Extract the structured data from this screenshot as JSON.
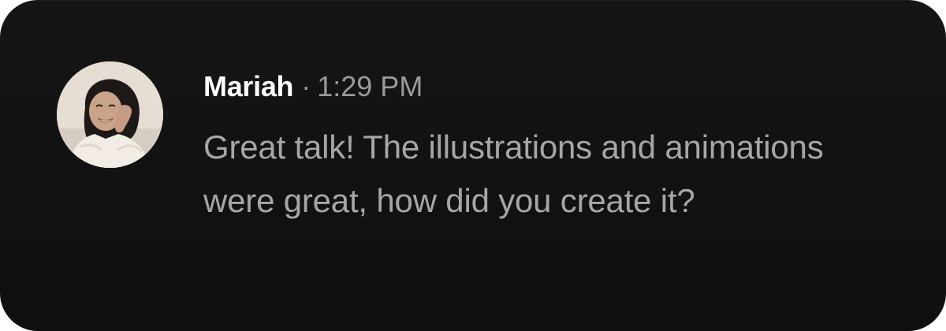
{
  "message": {
    "author": "Mariah",
    "separator": "·",
    "time": "1:29 PM",
    "text": "Great talk! The illustrations and animations were great, how did you create it?",
    "avatar_icon": "user-avatar-photo"
  },
  "colors": {
    "card_background": "#121212",
    "author_text": "#ffffff",
    "meta_text": "#9a9a9a",
    "body_text": "#a6a6a6"
  }
}
